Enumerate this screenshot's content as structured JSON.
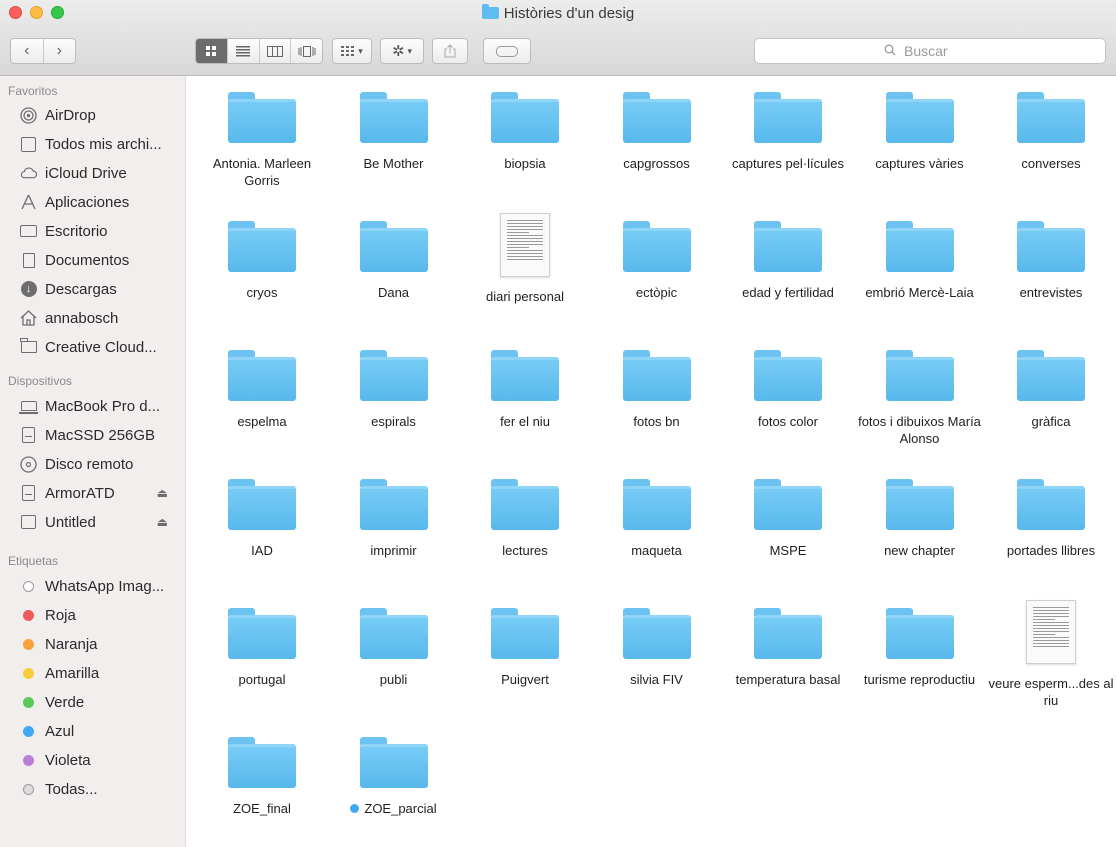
{
  "window": {
    "title": "Històries d'un desig"
  },
  "toolbar": {
    "back_glyph": "‹",
    "forward_glyph": "›",
    "view_icons": [
      "icon-view-icon",
      "list-view-icon",
      "column-view-icon",
      "coverflow-view-icon"
    ],
    "search_placeholder": "Buscar"
  },
  "sidebar": {
    "favorites_title": "Favoritos",
    "favorites": [
      {
        "label": "AirDrop",
        "icon": "airdrop-icon"
      },
      {
        "label": "Todos mis archi...",
        "icon": "all-files-icon"
      },
      {
        "label": "iCloud Drive",
        "icon": "cloud-icon"
      },
      {
        "label": "Aplicaciones",
        "icon": "applications-icon"
      },
      {
        "label": "Escritorio",
        "icon": "desktop-icon"
      },
      {
        "label": "Documentos",
        "icon": "documents-icon"
      },
      {
        "label": "Descargas",
        "icon": "downloads-icon"
      },
      {
        "label": "annabosch",
        "icon": "home-icon"
      },
      {
        "label": "Creative Cloud...",
        "icon": "folder-icon"
      }
    ],
    "devices_title": "Dispositivos",
    "devices": [
      {
        "label": "MacBook Pro d...",
        "icon": "laptop-icon",
        "eject": false
      },
      {
        "label": "MacSSD 256GB",
        "icon": "drive-icon",
        "eject": false
      },
      {
        "label": "Disco remoto",
        "icon": "disc-icon",
        "eject": false
      },
      {
        "label": "ArmorATD",
        "icon": "drive-icon",
        "eject": true
      },
      {
        "label": "Untitled",
        "icon": "drive-icon",
        "eject": true
      }
    ],
    "tags_title": "Etiquetas",
    "tags": [
      {
        "label": "WhatsApp Imag...",
        "color": ""
      },
      {
        "label": "Roja",
        "color": "#f05a5a"
      },
      {
        "label": "Naranja",
        "color": "#f9a13a"
      },
      {
        "label": "Amarilla",
        "color": "#f7cc3b"
      },
      {
        "label": "Verde",
        "color": "#5ac95a"
      },
      {
        "label": "Azul",
        "color": "#3fa9f5"
      },
      {
        "label": "Violeta",
        "color": "#b77fd6"
      },
      {
        "label": "Todas...",
        "color": ""
      }
    ]
  },
  "files": [
    {
      "name": "Antonia. Marleen Gorris",
      "kind": "folder"
    },
    {
      "name": "Be Mother",
      "kind": "folder"
    },
    {
      "name": "biopsia",
      "kind": "folder"
    },
    {
      "name": "capgrossos",
      "kind": "folder"
    },
    {
      "name": "captures pel·lícules",
      "kind": "folder"
    },
    {
      "name": "captures vàries",
      "kind": "folder"
    },
    {
      "name": "converses",
      "kind": "folder"
    },
    {
      "name": "cryos",
      "kind": "folder"
    },
    {
      "name": "Dana",
      "kind": "folder"
    },
    {
      "name": "diari personal",
      "kind": "document"
    },
    {
      "name": "ectòpic",
      "kind": "folder"
    },
    {
      "name": "edad y fertilidad",
      "kind": "folder"
    },
    {
      "name": "embrió Mercè-Laia",
      "kind": "folder"
    },
    {
      "name": "entrevistes",
      "kind": "folder"
    },
    {
      "name": "espelma",
      "kind": "folder"
    },
    {
      "name": "espirals",
      "kind": "folder"
    },
    {
      "name": "fer el niu",
      "kind": "folder"
    },
    {
      "name": "fotos bn",
      "kind": "folder"
    },
    {
      "name": "fotos color",
      "kind": "folder"
    },
    {
      "name": "fotos i dibuixos María Alonso",
      "kind": "folder"
    },
    {
      "name": "gràfica",
      "kind": "folder"
    },
    {
      "name": "IAD",
      "kind": "folder"
    },
    {
      "name": "imprimir",
      "kind": "folder"
    },
    {
      "name": "lectures",
      "kind": "folder"
    },
    {
      "name": "maqueta",
      "kind": "folder"
    },
    {
      "name": "MSPE",
      "kind": "folder"
    },
    {
      "name": "new chapter",
      "kind": "folder"
    },
    {
      "name": "portades llibres",
      "kind": "folder"
    },
    {
      "name": "portugal",
      "kind": "folder"
    },
    {
      "name": "publi",
      "kind": "folder"
    },
    {
      "name": "Puigvert",
      "kind": "folder"
    },
    {
      "name": "silvia FIV",
      "kind": "folder"
    },
    {
      "name": "temperatura basal",
      "kind": "folder"
    },
    {
      "name": "turisme reproductiu",
      "kind": "folder"
    },
    {
      "name": "veure esperm...des al riu",
      "kind": "document"
    },
    {
      "name": "ZOE_final",
      "kind": "folder"
    },
    {
      "name": "ZOE_parcial",
      "kind": "folder",
      "tag_color": "#3fa9f5"
    }
  ]
}
